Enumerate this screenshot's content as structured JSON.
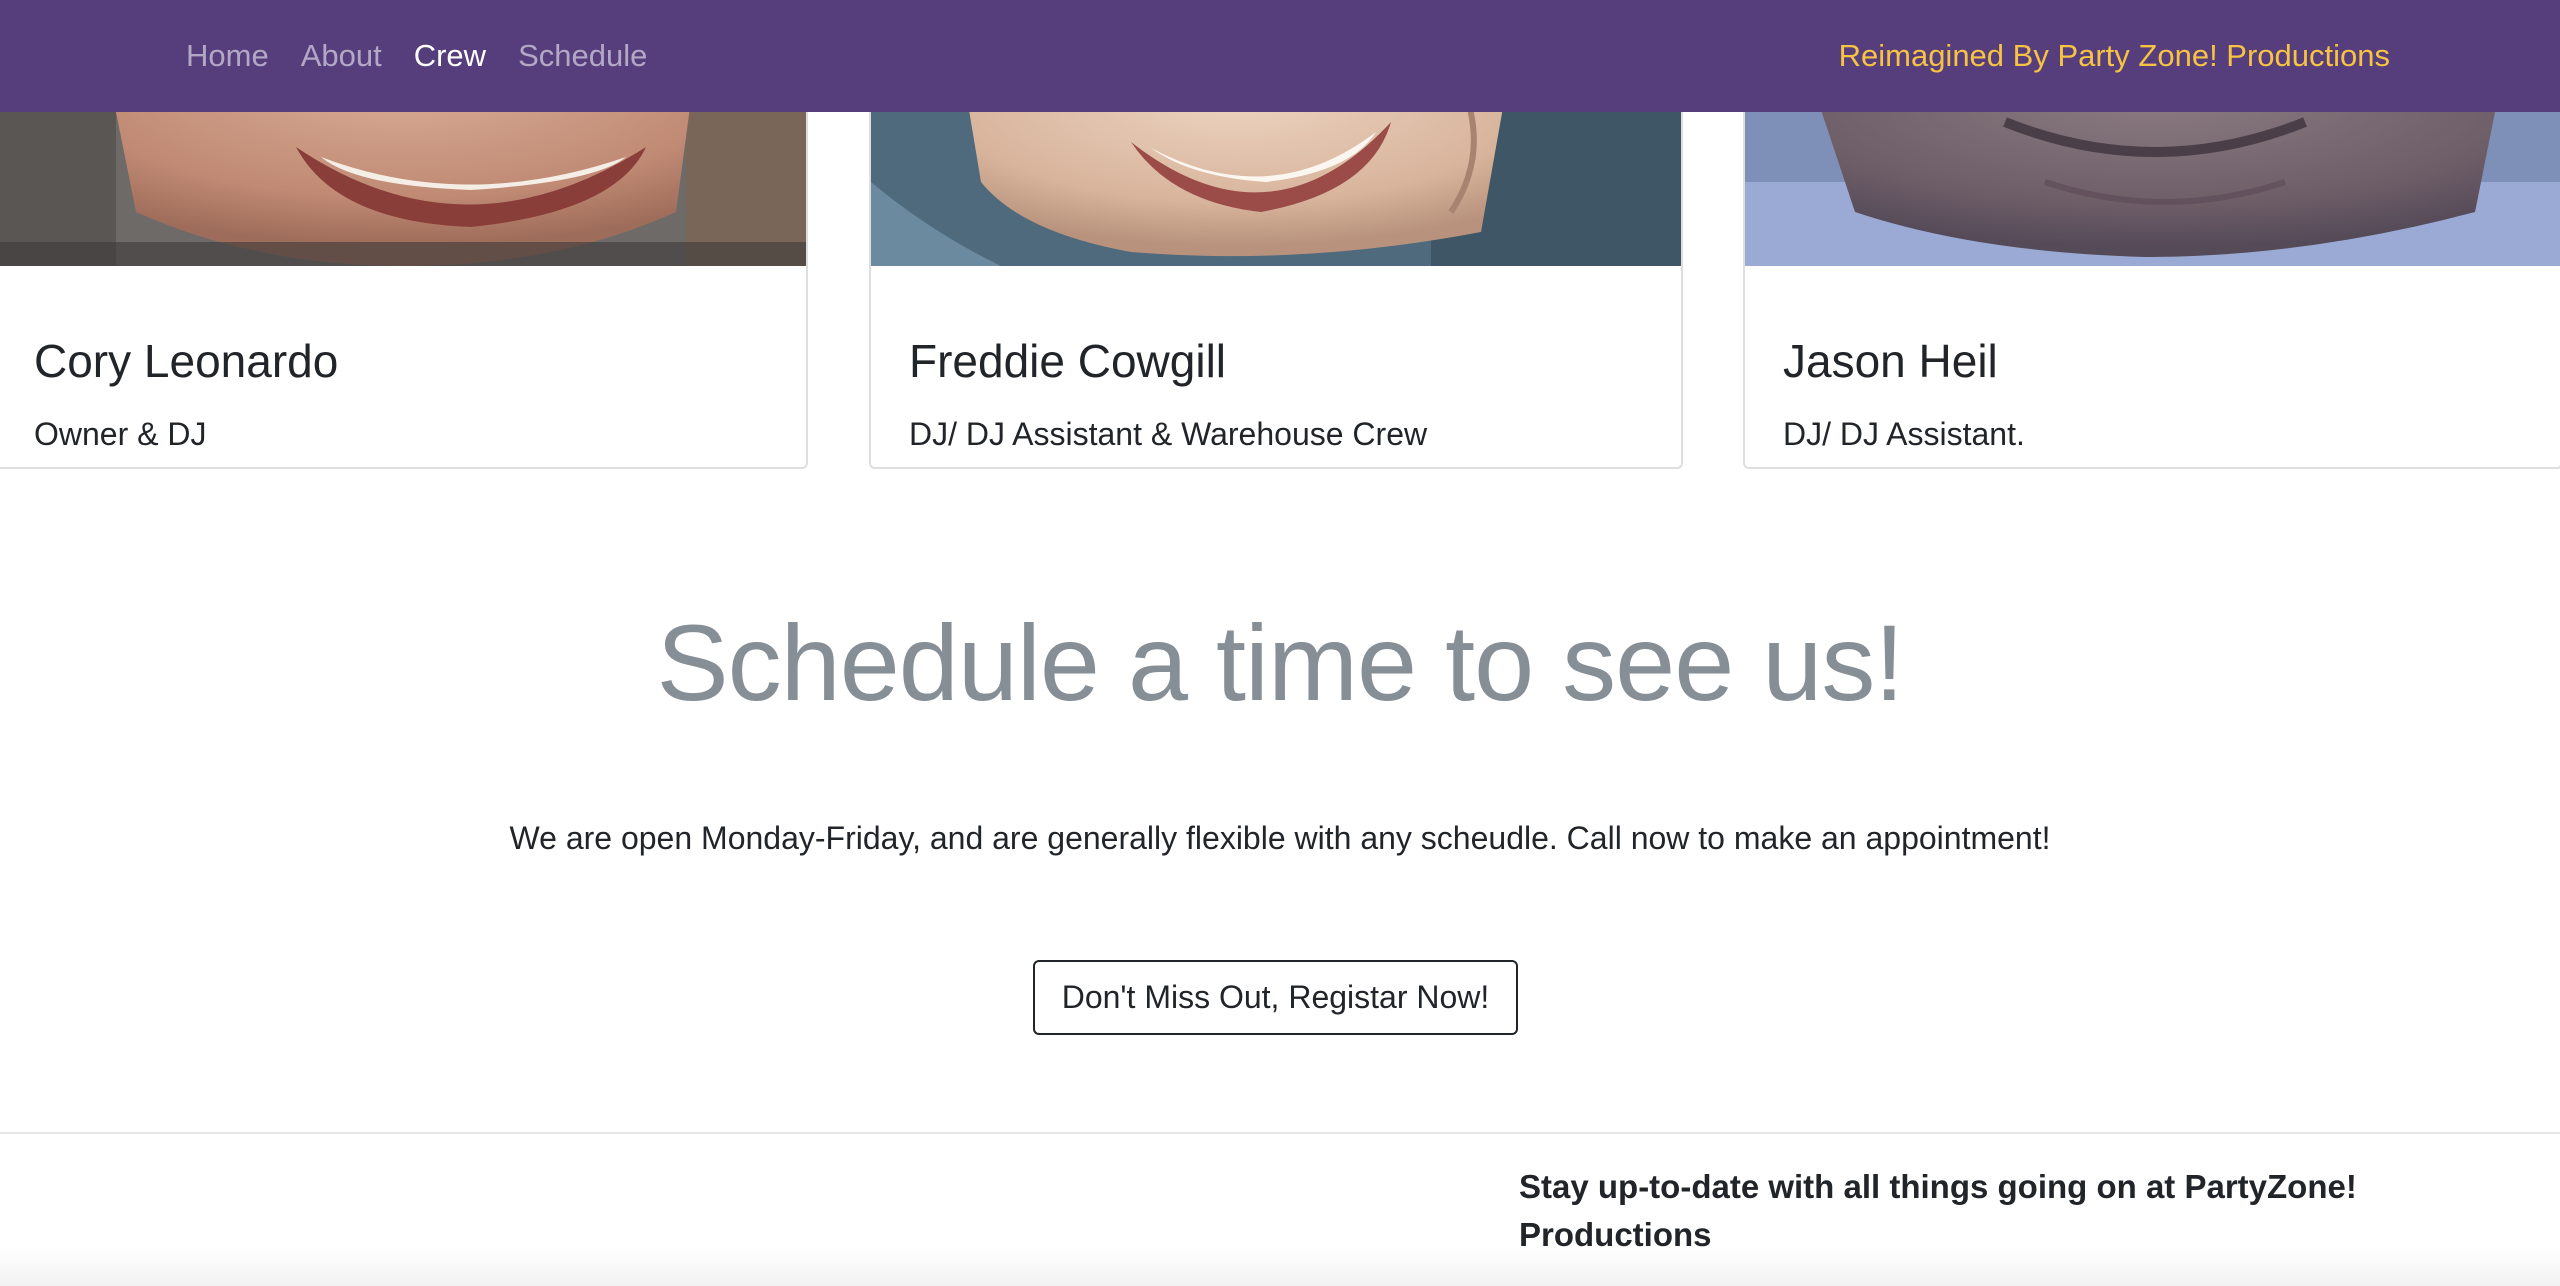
{
  "navbar": {
    "links": [
      {
        "label": "Home",
        "active": false
      },
      {
        "label": "About",
        "active": false
      },
      {
        "label": "Crew",
        "active": true
      },
      {
        "label": "Schedule",
        "active": false
      }
    ],
    "brand": "Reimagined By Party Zone! Productions"
  },
  "crew": [
    {
      "name": "Cory Leonardo",
      "role": "Owner & DJ"
    },
    {
      "name": "Freddie Cowgill",
      "role": "DJ/ DJ Assistant & Warehouse Crew"
    },
    {
      "name": "Jason Heil",
      "role": "DJ/ DJ Assistant."
    }
  ],
  "schedule": {
    "heading": "Schedule a time to see us!",
    "text": "We are open Monday-Friday, and are generally flexible with any scheudle. Call now to make an appointment!",
    "button_label": "Don't Miss Out, Registar Now!"
  },
  "footer": {
    "text": "Stay up-to-date with all things going on at PartyZone! Productions"
  },
  "colors": {
    "navbar_bg": "#563d7c",
    "brand": "#f6c343",
    "heading": "#868e96"
  }
}
